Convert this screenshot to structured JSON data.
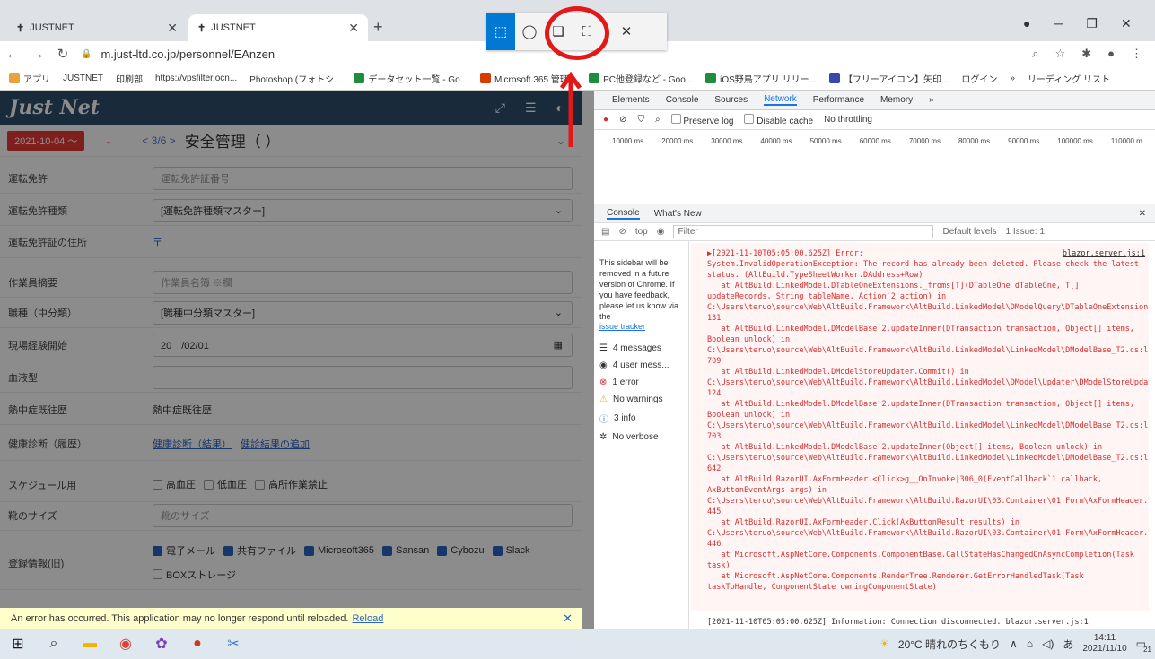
{
  "browser": {
    "tabs": [
      {
        "label": "JUSTNET"
      },
      {
        "label": "JUSTNET"
      }
    ],
    "url": "m.just-ltd.co.jp/personnel/EAnzen",
    "bookmarks": [
      "アプリ",
      "JUSTNET",
      "印刷部",
      "https://vpsfilter.ocn...",
      "Photoshop (フォトシ...",
      "データセット一覧 - Go...",
      "Microsoft 365 管理...",
      "PC他登録など - Goo...",
      "iOS野鳥アプリ リリー...",
      "【フリーアイコン】矢印...",
      "ログイン",
      "»",
      "リーディング リスト"
    ]
  },
  "snip": {
    "buttons": [
      "rect-snip",
      "free-snip",
      "window-snip",
      "fullscreen-snip",
      "close"
    ]
  },
  "app": {
    "logo": "Just Net",
    "date_badge": "2021-10-04 〜",
    "pager": "< 3/6 >",
    "title": "安全管理（ ）",
    "fields": [
      {
        "label": "運転免許",
        "value": "運転免許証番号",
        "placeholder": true
      },
      {
        "label": "運転免許種類",
        "value": "[運転免許種類マスター]",
        "placeholder": false
      },
      {
        "label": "運転免許証の住所",
        "value": "〒",
        "placeholder": false
      },
      {
        "label": "作業員摘要",
        "value": "作業員名簿 ※欄",
        "placeholder": true
      },
      {
        "label": "職種（中分類）",
        "value": "[職種中分類マスター]",
        "placeholder": false
      },
      {
        "label": "現場経験開始",
        "value": "20　/02/01",
        "placeholder": false
      },
      {
        "label": "血液型",
        "value": "",
        "placeholder": true
      },
      {
        "label": "熱中症既往歴",
        "value": "熱中症既往歴",
        "placeholder": false
      },
      {
        "label": "健康診断（履歴）",
        "value": "健康診断（結果）",
        "link2": "健診結果の追加"
      },
      {
        "label": "スケジュール用",
        "checks": [
          "高血圧",
          "低血圧",
          "高所作業禁止"
        ]
      },
      {
        "label": "靴のサイズ",
        "value": "靴のサイズ",
        "placeholder": true
      },
      {
        "label": "登録情報(旧)",
        "checks": [
          "電子メール",
          "共有ファイル",
          "Microsoft365",
          "Sansan",
          "Cybozu",
          "Slack"
        ],
        "extra": "BOXストレージ"
      }
    ],
    "error_bar": {
      "text": "An error has occurred. This application may no longer respond until reloaded.",
      "link": "Reload",
      "close": "✕"
    }
  },
  "devtools": {
    "tabs": [
      "Elements",
      "Console",
      "Sources",
      "Network",
      "Performance",
      "Memory",
      "»"
    ],
    "net_toolbar": [
      "Preserve log",
      "Disable cache",
      "No throttling"
    ],
    "timeline": [
      "10000 ms",
      "20000 ms",
      "30000 ms",
      "40000 ms",
      "50000 ms",
      "60000 ms",
      "70000 ms",
      "80000 ms",
      "90000 ms",
      "100000 ms",
      "110000 m"
    ],
    "drawer_tabs": [
      "Console",
      "What's New"
    ],
    "filter": {
      "context": "top",
      "placeholder": "Filter",
      "levels": "Default levels",
      "issues": "1 Issue: 1"
    },
    "sidebar_note": "This sidebar will be removed in a future version of Chrome. If you have feedback, please let us know via the",
    "sidebar_link": "issue tracker",
    "sidebar_items": [
      "4 messages",
      "4 user mess...",
      "1 error",
      "No warnings",
      "3 info",
      "No verbose"
    ],
    "console_source": "blazor.server.js:1",
    "console_error": "▶[2021-11-10T05:05:00.625Z] Error:\nSystem.InvalidOperationException: The record has already been deleted. Please check the latest status. (AltBuild.TypeSheetWorker.DAddress+Row)\n   at AltBuild.LinkedModel.DTableOneExtensions._froms[T](DTableOne dTableOne, T[] updateRecords, String tableName, Action`2 action) in C:\\Users\\teruo\\source\\Web\\AltBuild.Framework\\AltBuild.LinkedModel\\DModelQuery\\DTableOneExtensions.cs:line 131\n   at AltBuild.LinkedModel.DModelBase`2.updateInner(DTransaction transaction, Object[] items, Boolean unlock) in C:\\Users\\teruo\\source\\Web\\AltBuild.Framework\\AltBuild.LinkedModel\\LinkedModel\\DModelBase_T2.cs:line 709\n   at AltBuild.LinkedModel.DModelStoreUpdater.Commit() in C:\\Users\\teruo\\source\\Web\\AltBuild.Framework\\AltBuild.LinkedModel\\DModel\\Updater\\DModelStoreUpdater.cs:line 124\n   at AltBuild.LinkedModel.DModelBase`2.updateInner(DTransaction transaction, Object[] items, Boolean unlock) in C:\\Users\\teruo\\source\\Web\\AltBuild.Framework\\AltBuild.LinkedModel\\LinkedModel\\DModelBase_T2.cs:line 703\n   at AltBuild.LinkedModel.DModelBase`2.updateInner(Object[] items, Boolean unlock) in C:\\Users\\teruo\\source\\Web\\AltBuild.Framework\\AltBuild.LinkedModel\\LinkedModel\\DModelBase_T2.cs:line 642\n   at AltBuild.RazorUI.AxFormHeader.<Click>g__OnInvoke|306_0(EventCallback`1 callback, AxButtonEventArgs args) in C:\\Users\\teruo\\source\\Web\\AltBuild.Framework\\AltBuild.RazorUI\\03.Container\\01.Form\\AxFormHeader.razor:line 445\n   at AltBuild.RazorUI.AxFormHeader.Click(AxButtonResult results) in C:\\Users\\teruo\\source\\Web\\AltBuild.Framework\\AltBuild.RazorUI\\03.Container\\01.Form\\AxFormHeader.razor:line 446\n   at Microsoft.AspNetCore.Components.ComponentBase.CallStateHasChangedOnAsyncCompletion(Task task)\n   at Microsoft.AspNetCore.Components.RenderTree.Renderer.GetErrorHandledTask(Task taskToHandle, ComponentState owningComponentState)",
    "console_info": "[2021-11-10T05:05:00.625Z] Information: Connection disconnected.  blazor.server.js:1"
  },
  "taskbar": {
    "weather": "20°C 晴れのちくもり",
    "ime": "あ",
    "time": "14:11",
    "date": "2021/11/10",
    "badge": "21"
  }
}
